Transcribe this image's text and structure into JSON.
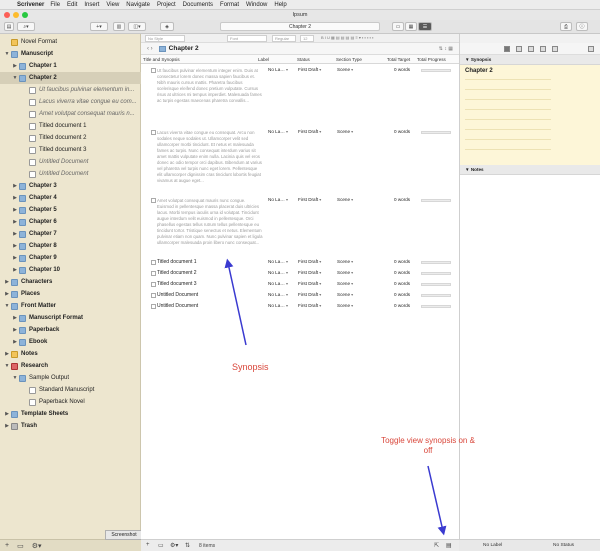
{
  "menubar": {
    "app": "Scrivener",
    "items": [
      "File",
      "Edit",
      "Insert",
      "View",
      "Navigate",
      "Project",
      "Documents",
      "Format",
      "Window",
      "Help"
    ]
  },
  "window": {
    "title": "Ipsum",
    "toolbar_title": "Chapter 2"
  },
  "binder": {
    "items": [
      {
        "label": "Novel Format",
        "level": 0,
        "icon": "yellow",
        "tri": "",
        "style": ""
      },
      {
        "label": "Manuscript",
        "level": 0,
        "icon": "folder",
        "tri": "▼",
        "style": "bold"
      },
      {
        "label": "Chapter 1",
        "level": 1,
        "icon": "folder",
        "tri": "▶",
        "style": "bold"
      },
      {
        "label": "Chapter 2",
        "level": 1,
        "icon": "folder",
        "tri": "▼",
        "style": "bold",
        "selected": true
      },
      {
        "label": "Ut faucibus pulvinar elementum in...",
        "level": 2,
        "icon": "doc",
        "tri": "",
        "style": "ital"
      },
      {
        "label": "Lacus viverra vitae congue eu com...",
        "level": 2,
        "icon": "doc",
        "tri": "",
        "style": "ital"
      },
      {
        "label": "Amet volutpat consequat mauris n...",
        "level": 2,
        "icon": "doc",
        "tri": "",
        "style": "ital"
      },
      {
        "label": "Titled document 1",
        "level": 2,
        "icon": "doc",
        "tri": "",
        "style": ""
      },
      {
        "label": "Titled document 2",
        "level": 2,
        "icon": "doc",
        "tri": "",
        "style": ""
      },
      {
        "label": "Titled document 3",
        "level": 2,
        "icon": "doc",
        "tri": "",
        "style": ""
      },
      {
        "label": "Untitled Document",
        "level": 2,
        "icon": "doc",
        "tri": "",
        "style": "ital"
      },
      {
        "label": "Untitled Document",
        "level": 2,
        "icon": "doc",
        "tri": "",
        "style": "ital"
      },
      {
        "label": "Chapter 3",
        "level": 1,
        "icon": "folder",
        "tri": "▶",
        "style": "bold"
      },
      {
        "label": "Chapter 4",
        "level": 1,
        "icon": "folder",
        "tri": "▶",
        "style": "bold"
      },
      {
        "label": "Chapter 5",
        "level": 1,
        "icon": "folder",
        "tri": "▶",
        "style": "bold"
      },
      {
        "label": "Chapter 6",
        "level": 1,
        "icon": "folder",
        "tri": "▶",
        "style": "bold"
      },
      {
        "label": "Chapter 7",
        "level": 1,
        "icon": "folder",
        "tri": "▶",
        "style": "bold"
      },
      {
        "label": "Chapter 8",
        "level": 1,
        "icon": "folder",
        "tri": "▶",
        "style": "bold"
      },
      {
        "label": "Chapter 9",
        "level": 1,
        "icon": "folder",
        "tri": "▶",
        "style": "bold"
      },
      {
        "label": "Chapter 10",
        "level": 1,
        "icon": "folder",
        "tri": "▶",
        "style": "bold"
      },
      {
        "label": "Characters",
        "level": 0,
        "icon": "folder",
        "tri": "▶",
        "style": "bold"
      },
      {
        "label": "Places",
        "level": 0,
        "icon": "folder",
        "tri": "▶",
        "style": "bold"
      },
      {
        "label": "Front Matter",
        "level": 0,
        "icon": "folder",
        "tri": "▼",
        "style": "bold"
      },
      {
        "label": "Manuscript Format",
        "level": 1,
        "icon": "folder",
        "tri": "▶",
        "style": "bold"
      },
      {
        "label": "Paperback",
        "level": 1,
        "icon": "folder",
        "tri": "▶",
        "style": "bold"
      },
      {
        "label": "Ebook",
        "level": 1,
        "icon": "folder",
        "tri": "▶",
        "style": "bold"
      },
      {
        "label": "Notes",
        "level": 0,
        "icon": "yellow",
        "tri": "▶",
        "style": "bold"
      },
      {
        "label": "Research",
        "level": 0,
        "icon": "red",
        "tri": "▼",
        "style": "bold"
      },
      {
        "label": "Sample Output",
        "level": 1,
        "icon": "folder",
        "tri": "▼",
        "style": ""
      },
      {
        "label": "Standard Manuscript",
        "level": 2,
        "icon": "doc",
        "tri": "",
        "style": ""
      },
      {
        "label": "Paperback Novel",
        "level": 2,
        "icon": "doc",
        "tri": "",
        "style": ""
      },
      {
        "label": "Template Sheets",
        "level": 0,
        "icon": "folder",
        "tri": "▶",
        "style": "bold"
      },
      {
        "label": "Trash",
        "level": 0,
        "icon": "grey",
        "tri": "▶",
        "style": "bold"
      }
    ],
    "tooltip": "Screenshot"
  },
  "main": {
    "header_title": "Chapter 2",
    "columns": [
      "Title and Synopsis",
      "Label",
      "Status",
      "Section Type",
      "Total Target",
      "Total Progress"
    ],
    "synopsis_rows": [
      {
        "synopsis": "Ut faucibus pulvinar elementum integer enim. Duis at consectetur lorem donec massa sapien faucibus et. Nibh mauris cursus mattis. Pharetra faucibus scelerisque eleifend donec pretium vulputate. Cursus risus at ultrices mi tempus imperdiet. Malesuada fames ac turpis egestas maecenas pharetra convallis...",
        "label": "No La…",
        "status": "First Draft",
        "section": "Scene",
        "target": "0 words"
      },
      {
        "synopsis": "Lacus viverra vitae congue eu consequat. Arcu non sodales neque sodales ut. Ullamcorper velit sed ullamcorper morbi tincidunt. Et netus et malesuada fames ac turpis. Nunc consequat interdum varius sit amet mattis vulputate enim nulla. Lacinia quis vel eros donec ac odio tempor orci dapibus. Bibendum at varius vel pharetra vel turpis nunc eget lorem. Pellentesque elit ullamcorper dignissim cras tincidunt lobortis feugiat vivamus at augue eget...",
        "label": "No La…",
        "status": "First Draft",
        "section": "Scene",
        "target": "0 words"
      },
      {
        "synopsis": "Amet volutpat consequat mauris nunc congue. Euismod in pellentesque massa placerat duis ultricies lacus. Morbi tempus iaculis urna id volutpat. Tincidunt augue interdum velit euismod in pellentesque. Orci phasellus egestas tellus rutrum tellus pellentesque eu tincidunt tortor. Tristique senectus et netus. Elementum pulvinar etiam non quam. Nunc pulvinar sapien et ligula ullamcorper malesuada proin libero nunc consequat...",
        "label": "No La…",
        "status": "First Draft",
        "section": "Scene",
        "target": "0 words"
      }
    ],
    "title_rows": [
      {
        "title": "Titled document 1",
        "label": "No La…",
        "status": "First Draft",
        "section": "Scene",
        "target": "0 words"
      },
      {
        "title": "Titled document 2",
        "label": "No La…",
        "status": "First Draft",
        "section": "Scene",
        "target": "0 words"
      },
      {
        "title": "Titled document 3",
        "label": "No La…",
        "status": "First Draft",
        "section": "Scene",
        "target": "0 words"
      },
      {
        "title": "Untitled Document",
        "label": "No La…",
        "status": "First Draft",
        "section": "Scene",
        "target": "0 words"
      },
      {
        "title": "Untitled Document",
        "label": "No La…",
        "status": "First Draft",
        "section": "Scene",
        "target": "0 words"
      }
    ],
    "footer": {
      "items_text": "8 items"
    }
  },
  "inspector": {
    "synopsis_header": "Synopsis",
    "synopsis_title": "Chapter 2",
    "notes_header": "Notes",
    "footer_label": "No Label",
    "footer_status": "No Status"
  },
  "annotations": {
    "synopsis": "Synopsis",
    "toggle": "Toggle view synopsis on & off",
    "color": "#d9463a",
    "arrow_color": "#3a3ad0"
  }
}
